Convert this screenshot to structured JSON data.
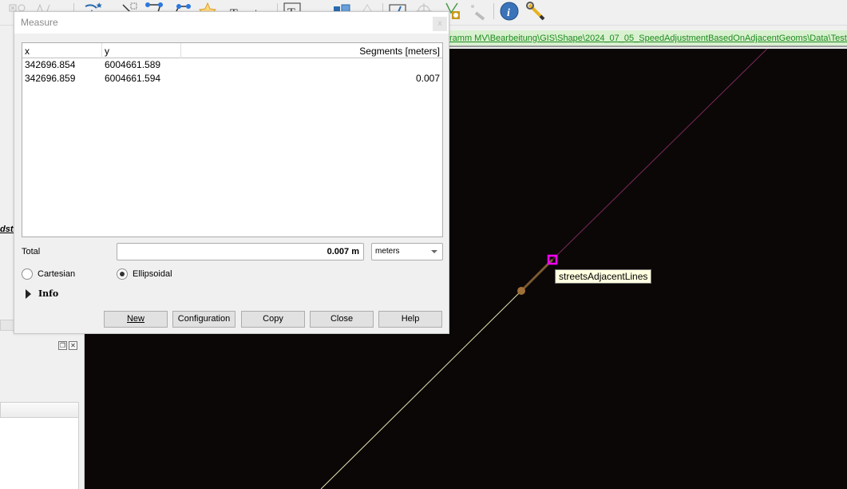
{
  "toolbar": {
    "icons": [
      "digitize-icon",
      "vertex-tool-icon",
      "node-tool-icon",
      "label-pin-icon",
      "select-feature-icon",
      "polygon-icon",
      "line-icon",
      "star-icon",
      "text-annotation-icon",
      "abc-label-icon",
      "text-box-icon",
      "layer-icon",
      "triangle-icon",
      "measure-icon",
      "crosshair-icon",
      "snapping-icon",
      "identify-disabled-icon",
      "info-icon",
      "settings-wrench-icon"
    ]
  },
  "path_bar": {
    "text": "ramm MV\\Bearbeitung\\GIS\\Shape\\2024_07_05_SpeedAdjustmentBasedOnAdjacentGeoms\\Data\\Testdata\\smaller"
  },
  "left_dock": {
    "italic_text": "dstr"
  },
  "map": {
    "tooltip": "streetsAdjacentLines",
    "colors": {
      "background": "#0b0707",
      "magenta_line": "#7a2a5a",
      "yellow_line": "#e8e4b0",
      "measure_line": "#7a5a30",
      "snap_marker": "#ff00ff",
      "vertex": "#a07038"
    }
  },
  "dialog": {
    "title": "Measure",
    "close_glyph": "x",
    "table": {
      "columns": [
        "x",
        "y",
        "Segments [meters]"
      ],
      "rows": [
        {
          "x": "342696.854",
          "y": "6004661.589",
          "segment": ""
        },
        {
          "x": "342696.859",
          "y": "6004661.594",
          "segment": "0.007"
        }
      ]
    },
    "total_label": "Total",
    "total_value": "0.007 m",
    "units": "meters",
    "radio_cartesian": "Cartesian",
    "radio_ellipsoidal": "Ellipsoidal",
    "selected_mode": "Ellipsoidal",
    "info_label": "Info",
    "buttons": {
      "new": "New",
      "configuration": "Configuration",
      "copy": "Copy",
      "close": "Close",
      "help": "Help"
    }
  }
}
